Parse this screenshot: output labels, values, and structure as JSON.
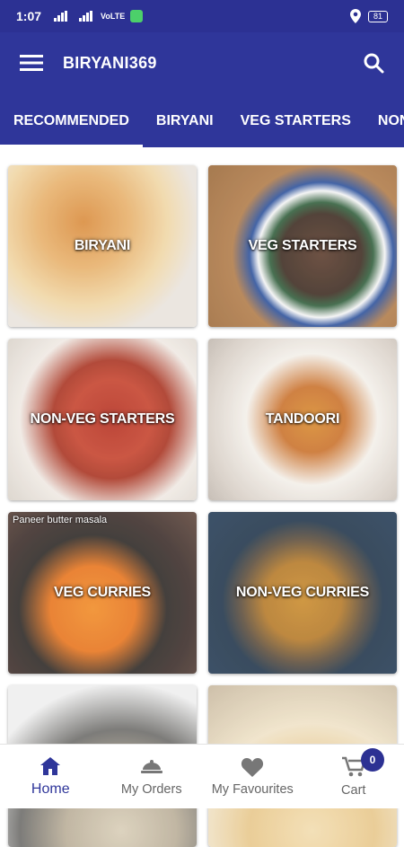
{
  "status_bar": {
    "time": "1:07",
    "network_label": "VoLTE",
    "battery": "81"
  },
  "app_bar": {
    "title": "BIRYANI369",
    "menu_icon": "hamburger-menu-icon",
    "search_icon": "search-icon"
  },
  "tabs": [
    {
      "label": "RECOMMENDED",
      "active": true
    },
    {
      "label": "BIRYANI",
      "active": false
    },
    {
      "label": "VEG STARTERS",
      "active": false
    },
    {
      "label": "NON",
      "active": false
    }
  ],
  "categories": [
    {
      "label": "BIRYANI"
    },
    {
      "label": "VEG STARTERS"
    },
    {
      "label": "NON-VEG STARTERS"
    },
    {
      "label": "TANDOORI"
    },
    {
      "label": "VEG CURRIES",
      "caption": "Paneer butter masala"
    },
    {
      "label": "NON-VEG CURRIES"
    },
    {
      "label": ""
    },
    {
      "label": ""
    }
  ],
  "bottom_nav": {
    "items": [
      {
        "label": "Home",
        "icon": "home-icon",
        "active": true
      },
      {
        "label": "My Orders",
        "icon": "orders-icon",
        "active": false
      },
      {
        "label": "My Favourites",
        "icon": "heart-icon",
        "active": false
      },
      {
        "label": "Cart",
        "icon": "cart-icon",
        "active": false
      }
    ],
    "cart_count": "0"
  },
  "colors": {
    "primary": "#2f369a",
    "status_bar": "#2c3193"
  }
}
